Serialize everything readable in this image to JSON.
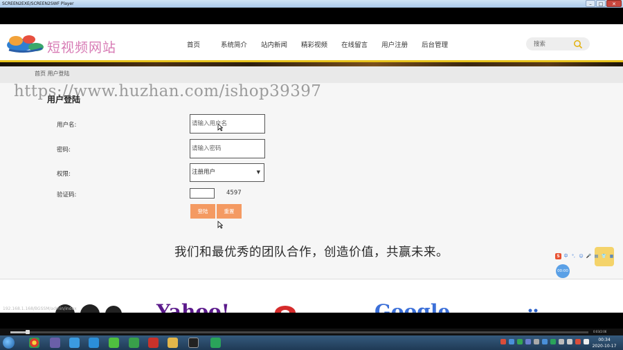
{
  "window": {
    "title": "SCREEN2EXE/SCREEN2SWF Player",
    "controls": {
      "minimize": "–",
      "maximize": "□",
      "close": "✕"
    }
  },
  "site": {
    "logo_text": "短视频网站",
    "nav": [
      "首页",
      "系统简介",
      "站内新闻",
      "精彩视频",
      "在线留言",
      "用户注册",
      "后台管理"
    ],
    "search_placeholder": "搜索",
    "breadcrumb": "首页 用户登陆",
    "watermark": "https://www.huzhan.com/ishop39397"
  },
  "login": {
    "title": "用户登陆",
    "username_label": "用户名:",
    "username_placeholder": "请输入用户名",
    "password_label": "密码:",
    "password_placeholder": "请输入密码",
    "role_label": "权限:",
    "role_selected": "注册用户",
    "captcha_label": "验证码:",
    "captcha_code": "4597",
    "login_button": "登陆",
    "reset_button": "重置"
  },
  "slogan": "我们和最优秀的团队合作，创造价值，共赢未来。",
  "float_widget": "00:00",
  "ime": [
    "S",
    "中",
    "°,",
    "☺",
    "🎤",
    "▤",
    "👕",
    "▦"
  ],
  "server_ip": "192.168.1.168/BGSSM/admin/index",
  "partners": [
    "Yahoo!",
    "Google"
  ],
  "player": {
    "time": "0:03/2:06"
  },
  "taskbar": {
    "time": "00:34",
    "date": "2020-10-17"
  },
  "colors": {
    "accent_button": "#f49a62",
    "header_line": "#e7c21b",
    "logo_pink": "#d77ab4"
  }
}
